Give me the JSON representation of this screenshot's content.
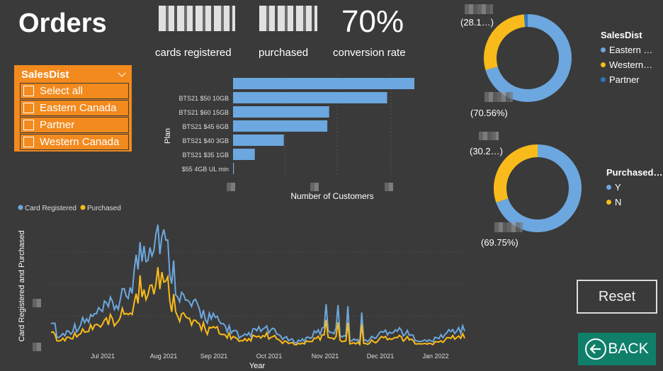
{
  "header": {
    "title": "Orders"
  },
  "kpis": [
    {
      "value": "",
      "label": "cards registered"
    },
    {
      "value": "",
      "label": "purchased"
    },
    {
      "value": "70%",
      "label": "conversion rate"
    }
  ],
  "slicer": {
    "title": "SalesDist",
    "items": [
      "Select all",
      "Eastern Canada",
      "Partner",
      "Western Canada"
    ]
  },
  "bar_chart": {
    "ylabel": "Plan",
    "xlabel": "Number of Customers",
    "bars": [
      {
        "label": "",
        "value": 100
      },
      {
        "label": "BTS21 $50 10GB",
        "value": 85
      },
      {
        "label": "BTS21 $60 15GB",
        "value": 53
      },
      {
        "label": "BTS21 $45 6GB",
        "value": 52
      },
      {
        "label": "BTS21 $40 3GB",
        "value": 28
      },
      {
        "label": "BTS21 $35 1GB",
        "value": 12
      },
      {
        "label": "$55 4GB UL min",
        "value": 0.5
      }
    ],
    "color": "#6ca7df"
  },
  "donut1": {
    "legend_title": "SalesDist",
    "legend": [
      {
        "label": "Eastern …",
        "color": "#6ca7df"
      },
      {
        "label": "Western…",
        "color": "#f9bb1b"
      },
      {
        "label": "Partner",
        "color": "#2f74c0"
      }
    ],
    "label_small": "(28.1…)",
    "label_large": "(70.56%)",
    "segments": [
      70.56,
      28.1,
      1.34
    ]
  },
  "donut2": {
    "legend_title": "Purchased…",
    "legend": [
      {
        "label": "Y",
        "color": "#6ca7df"
      },
      {
        "label": "N",
        "color": "#f9bb1b"
      }
    ],
    "label_small": "(30.2…)",
    "label_large": "(69.75%)",
    "segments": [
      69.75,
      30.25
    ]
  },
  "line_chart": {
    "legend": [
      {
        "label": "Card Registered",
        "color": "#6ca7df"
      },
      {
        "label": "Purchased",
        "color": "#f9bb1b"
      }
    ],
    "ylabel": "Card Registered and Purchased",
    "xlabel": "Year",
    "ticks": [
      "Jul 2021",
      "Aug 2021",
      "Sep 2021",
      "Oct 2021",
      "Nov 2021",
      "Dec 2021",
      "Jan 2022"
    ]
  },
  "buttons": {
    "reset": "Reset",
    "back": "BACK"
  },
  "chart_data": {
    "type": "bar",
    "ylabel": "Plan",
    "xlabel": "Number of Customers",
    "categories": [
      "",
      "BTS21 $50 10GB",
      "BTS21 $60 15GB",
      "BTS21 $45 6GB",
      "BTS21 $40 3GB",
      "BTS21 $35 1GB",
      "$55 4GB UL min"
    ],
    "values": [
      100,
      85,
      53,
      52,
      28,
      12,
      0.5
    ]
  }
}
